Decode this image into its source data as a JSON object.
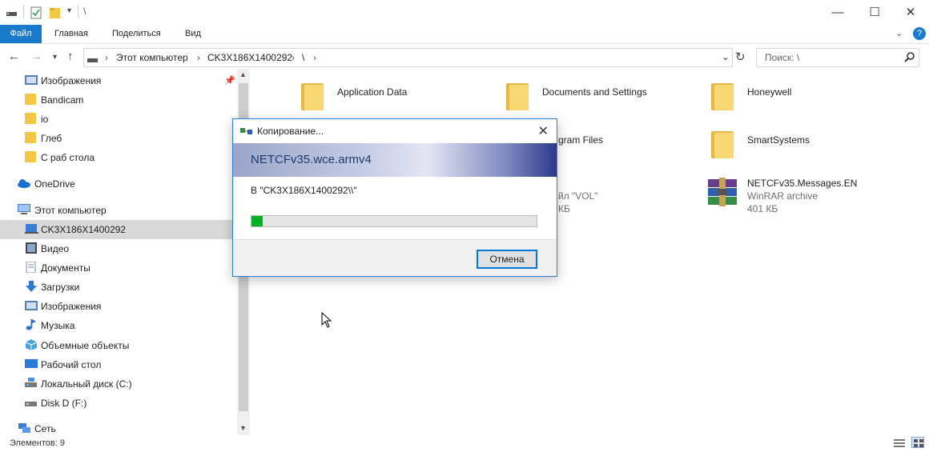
{
  "titlebar": {
    "path": "\\",
    "minimize": "—",
    "maximize": "☐",
    "close": "✕"
  },
  "ribbon": {
    "tabs": [
      "Файл",
      "Главная",
      "Поделиться",
      "Вид"
    ],
    "expand": "⌄",
    "help": "?"
  },
  "address": {
    "crumbs": [
      "Этот компьютер",
      "CK3X186X1400292",
      "\\"
    ],
    "sep": "›",
    "search_placeholder": "Поиск: \\"
  },
  "sidebar": {
    "items": [
      {
        "label": "Изображения",
        "icon": "pictures-icon"
      },
      {
        "label": "Bandicam",
        "icon": "folder-icon"
      },
      {
        "label": "io",
        "icon": "folder-icon"
      },
      {
        "label": "Глеб",
        "icon": "folder-icon"
      },
      {
        "label": "С раб стола",
        "icon": "folder-icon"
      },
      {
        "label": "OneDrive",
        "icon": "cloud-icon"
      },
      {
        "label": "Этот компьютер",
        "icon": "computer-icon"
      },
      {
        "label": "CK3X186X1400292",
        "icon": "device-icon"
      },
      {
        "label": "Видео",
        "icon": "video-icon"
      },
      {
        "label": "Документы",
        "icon": "documents-icon"
      },
      {
        "label": "Загрузки",
        "icon": "downloads-icon"
      },
      {
        "label": "Изображения",
        "icon": "pictures-icon"
      },
      {
        "label": "Музыка",
        "icon": "music-icon"
      },
      {
        "label": "Объемные объекты",
        "icon": "3d-objects-icon"
      },
      {
        "label": "Рабочий стол",
        "icon": "desktop-icon"
      },
      {
        "label": "Локальный диск (C:)",
        "icon": "drive-icon"
      },
      {
        "label": "Disk D (F:)",
        "icon": "drive-icon"
      },
      {
        "label": "Сеть",
        "icon": "network-icon"
      }
    ]
  },
  "content": {
    "items": [
      {
        "name": "Application Data"
      },
      {
        "name": "Documents and Settings"
      },
      {
        "name": "Honeywell"
      },
      {
        "name": "gram Files"
      },
      {
        "name": "SmartSystems"
      },
      {
        "name": "NETCFv35.Messages.EN",
        "type": "WinRAR archive",
        "size": "401 КБ"
      }
    ],
    "partial_type": "йл \"VOL\"",
    "partial_size": "КБ"
  },
  "status": {
    "count": "Элементов: 9"
  },
  "dialog": {
    "title": "Копирование...",
    "filename": "NETCFv35.wce.armv4",
    "destination": "В \"CK3X186X1400292\\\\\"",
    "progress": 0.04,
    "cancel": "Отмена",
    "progress_color": "#06b025"
  }
}
